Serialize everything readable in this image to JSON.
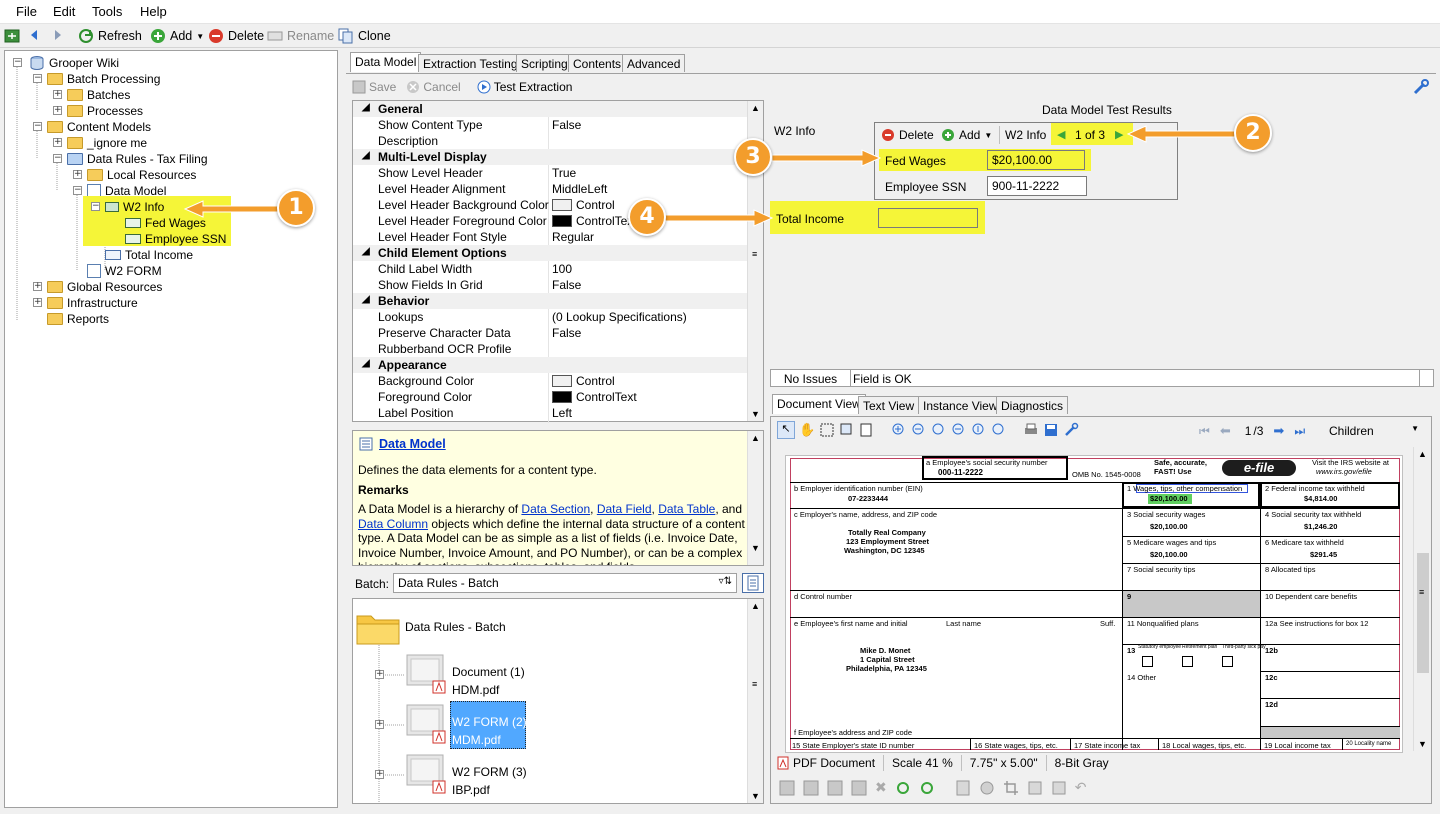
{
  "menu": [
    "File",
    "Edit",
    "Tools",
    "Help"
  ],
  "toolbar": {
    "refresh": "Refresh",
    "add": "Add",
    "delete": "Delete",
    "rename": "Rename",
    "clone": "Clone"
  },
  "tree": {
    "root": "Grooper Wiki",
    "batch_processing": "Batch Processing",
    "batches": "Batches",
    "processes": "Processes",
    "content_models": "Content Models",
    "ignore_me": "_ignore me",
    "data_rules": "Data Rules - Tax Filing",
    "local_resources": "Local Resources",
    "data_model": "Data Model",
    "w2_info": "W2 Info",
    "fed_wages": "Fed Wages",
    "employee_ssn": "Employee SSN",
    "total_income": "Total Income",
    "w2_form": "W2 FORM",
    "global_resources": "Global Resources",
    "infrastructure": "Infrastructure",
    "reports": "Reports"
  },
  "center_tabs": [
    "Data Model",
    "Extraction Testing",
    "Scripting",
    "Contents",
    "Advanced"
  ],
  "center_toolbar": {
    "save": "Save",
    "cancel": "Cancel",
    "test": "Test Extraction"
  },
  "props": [
    {
      "cat": "General"
    },
    {
      "k": "Show Content Type",
      "v": "False"
    },
    {
      "k": "Description",
      "v": ""
    },
    {
      "cat": "Multi-Level Display"
    },
    {
      "k": "Show Level Header",
      "v": "True"
    },
    {
      "k": "Level Header Alignment",
      "v": "MiddleLeft"
    },
    {
      "k": "Level Header Background Color",
      "v": "Control",
      "swatch": "#f0f0f0"
    },
    {
      "k": "Level Header Foreground Color",
      "v": "ControlText",
      "swatch": "#000000"
    },
    {
      "k": "Level Header Font Style",
      "v": "Regular"
    },
    {
      "cat": "Child Element Options"
    },
    {
      "k": "Child Label Width",
      "v": "100"
    },
    {
      "k": "Show Fields In Grid",
      "v": "False"
    },
    {
      "cat": "Behavior"
    },
    {
      "k": "Lookups",
      "v": "(0 Lookup Specifications)"
    },
    {
      "k": "Preserve Character Data",
      "v": "False"
    },
    {
      "k": "Rubberband OCR Profile",
      "v": ""
    },
    {
      "cat": "Appearance"
    },
    {
      "k": "Background Color",
      "v": "Control",
      "swatch": "#f0f0f0"
    },
    {
      "k": "Foreground Color",
      "v": "ControlText",
      "swatch": "#000000"
    },
    {
      "k": "Label Position",
      "v": "Left"
    }
  ],
  "help": {
    "title": "Data Model",
    "desc": "Defines the data elements for a content type.",
    "remarks_label": "Remarks",
    "p1": "A Data Model is a hierarchy of ",
    "l1": "Data Section",
    "l2": "Data Field",
    "l3": "Data Table",
    "and": ", and",
    "l4": "Data Column",
    "p2": " objects which define the internal data structure of a content type.  A Data Model can be as simple as a list of fields (i.e. Invoice Date, Invoice Number, Invoice Amount,  and PO Number), or can be a complex hierarchy of sections, subsections, tables, and fields."
  },
  "batch": {
    "label": "Batch:",
    "selected": "Data Rules - Batch",
    "root": "Data Rules - Batch",
    "docs": [
      {
        "name": "Document (1)",
        "file": "HDM.pdf"
      },
      {
        "name": "W2 FORM (2)",
        "file": "MDM.pdf"
      },
      {
        "name": "W2 FORM (3)",
        "file": "IBP.pdf"
      }
    ]
  },
  "test": {
    "title": "Data Model Test Results",
    "section_label": "W2 Info",
    "delete": "Delete",
    "add": "Add",
    "section_name": "W2 Info",
    "page_of": "1 of 3",
    "fields": [
      {
        "label": "Fed Wages",
        "value": "$20,100.00"
      },
      {
        "label": "Employee SSN",
        "value": "900-11-2222"
      }
    ],
    "total_label": "Total Income",
    "total_value": ""
  },
  "callouts": [
    "1",
    "2",
    "3",
    "4"
  ],
  "status": {
    "issues": "No Issues",
    "field": "Field is OK"
  },
  "doc_tabs": [
    "Document View",
    "Text View",
    "Instance View",
    "Diagnostics"
  ],
  "doc_nav": {
    "page": "1",
    "total": "/3",
    "mode": "Children"
  },
  "doc_status": {
    "type": "PDF Document",
    "scale": "Scale 41 %",
    "size": "7.75\" x 5.00\"",
    "depth": "8-Bit Gray"
  },
  "w2": {
    "a_label": "a  Employee's social security number",
    "ssn": "000-11-2222",
    "omb": "OMB No. 1545-0008",
    "safe1": "Safe, accurate,",
    "safe2": "FAST! Use",
    "efile": "e-file",
    "irs": "IRS",
    "visit1": "Visit the IRS website at",
    "visit2": "www.irs.gov/efile",
    "b_label": "b  Employer identification number (EIN)",
    "ein": "07-2233444",
    "c_label": "c  Employer's name, address, and ZIP code",
    "emp1": "Totally Real Company",
    "emp2": "123 Employment Street",
    "emp3": "Washington, DC 12345",
    "d_label": "d  Control number",
    "e_label": "e  Employee's first name and initial",
    "last_name": "Last name",
    "suff": "Suff.",
    "ee1": "Mike D. Monet",
    "ee2": "1 Capital Street",
    "ee3": "Philadelphia, PA 12345",
    "f_label": "f  Employee's address and ZIP code",
    "b1": "1  Wages, tips, other compensation",
    "v1": "$20,100.00",
    "b2": "2  Federal income tax withheld",
    "v2": "$4,814.00",
    "b3": "3  Social security wages",
    "v3": "$20,100.00",
    "b4": "4  Social security tax withheld",
    "v4": "$1,246.20",
    "b5": "5  Medicare wages and tips",
    "v5": "$20,100.00",
    "b6": "6  Medicare tax withheld",
    "v6": "$291.45",
    "b7": "7  Social security tips",
    "b8": "8  Allocated tips",
    "b9": "9",
    "b10": "10  Dependent care benefits",
    "b11": "11  Nonqualified plans",
    "b12a": "12a  See instructions for box 12",
    "b12b": "12b",
    "b12c": "12c",
    "b12d": "12d",
    "b13": "13",
    "stat": "Statutory employee",
    "ret": "Retirement plan",
    "tp": "Third-party sick pay",
    "b14": "14  Other",
    "b15": "15  State    Employer's state ID number",
    "b16": "16  State wages, tips, etc.",
    "b17": "17  State income tax",
    "b18": "18  Local wages, tips, etc.",
    "b19": "19  Local income tax",
    "b20": "20  Locality name"
  }
}
